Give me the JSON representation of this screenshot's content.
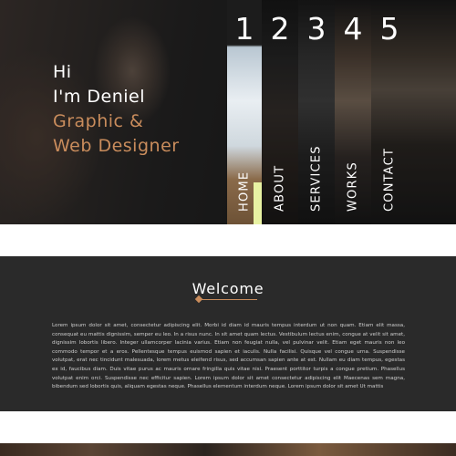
{
  "hero": {
    "greeting": "Hi",
    "name_line": "I'm Deniel",
    "role_line1": "Graphic &",
    "role_line2": "Web Designer",
    "accent_color": "#c98c5c"
  },
  "nav": {
    "items": [
      {
        "number": "1",
        "label": "HOME"
      },
      {
        "number": "2",
        "label": "ABOUT"
      },
      {
        "number": "3",
        "label": "SERVICES"
      },
      {
        "number": "4",
        "label": "WORKS"
      },
      {
        "number": "5",
        "label": "CONTACT"
      }
    ]
  },
  "welcome": {
    "title": "Welcome",
    "body": "Lorem ipsum dolor sit amet, consectetur adipiscing elit. Morbi id diam id mauris tempus interdum ut non quam. Etiam elit massa, consequat eu mattis dignissim, semper eu leo. In a risus nunc. In sit amet quam lectus. Vestibulum lectus enim, congue at velit sit amet, dignissim lobortis libero. Integer ullamcorper lacinia varius. Etiam non feugiat nulla, vel pulvinar velit. Etiam eget mauris non leo commodo tempor et a eros. Pellentesque tempus euismod sapien et iaculis. Nulla facilisi. Quisque vel congue urna. Suspendisse volutpat, erat nec tincidunt malesuada, lorem metus eleifend risus, sed accumsan sapien ante at est. Nullam eu diam tempus, egestas ex id, faucibus diam. Duis vitae purus ac mauris ornare fringilla quis vitae nisi. Praesent porttitor turpis a congue pretium. Phasellus volutpat enim orci. Suspendisse nec efficitur sapien. Lorem ipsum dolor sit amet consectetur adipiscing elit Maecenas sem magna, bibendum sed lobortis quis, aliquam egestas neque. Phasellus elementum interdum neque. Lorem ipsum dolor sit amet Ut mattis"
  }
}
